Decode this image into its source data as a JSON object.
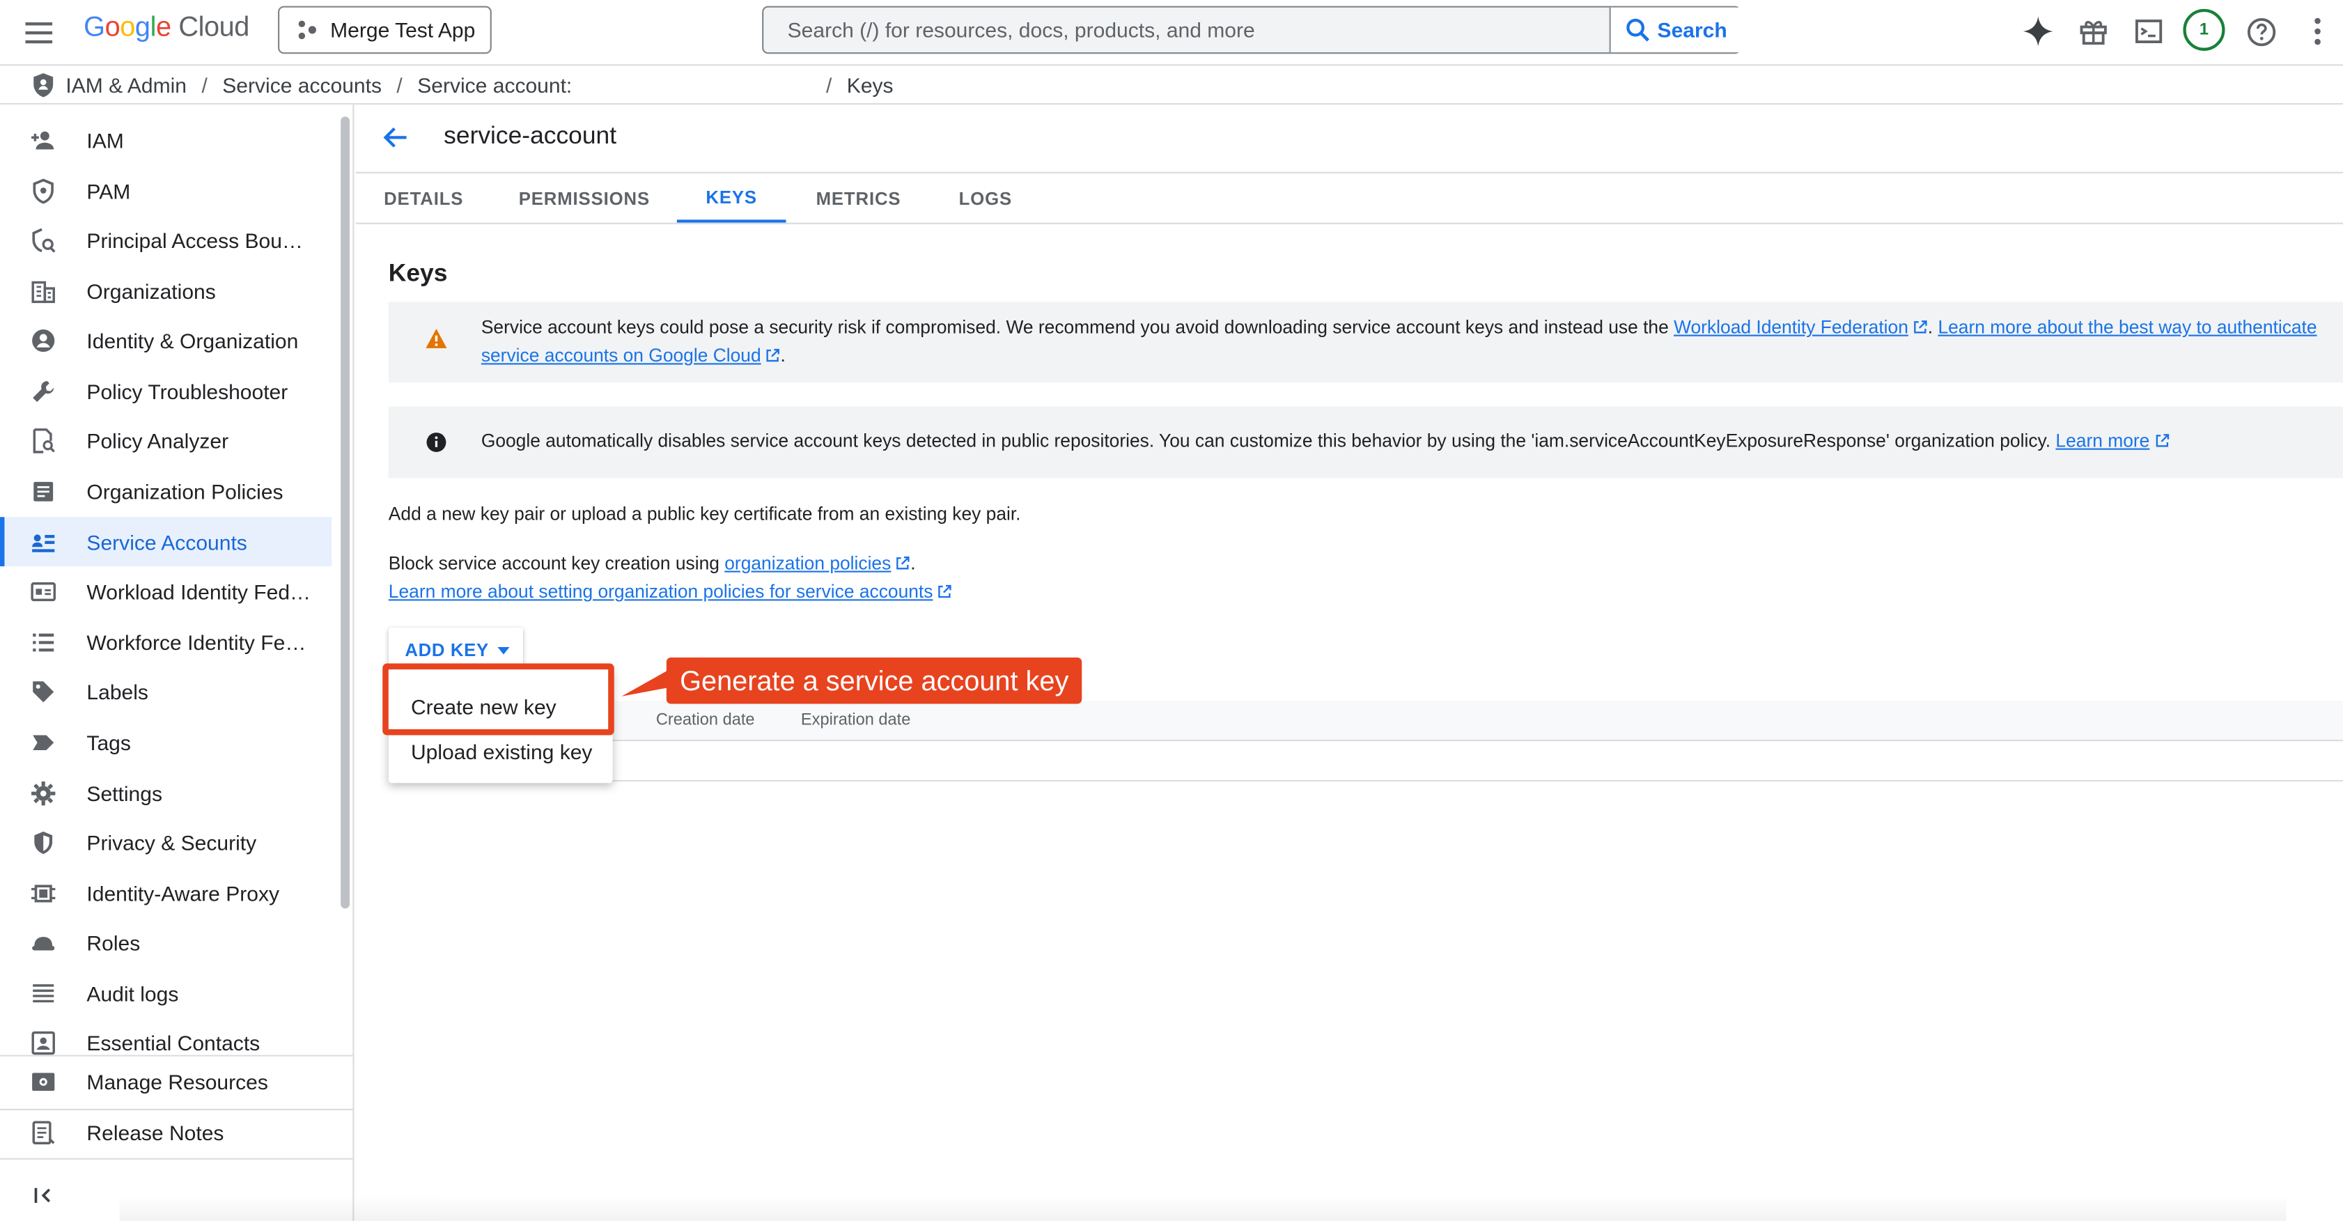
{
  "app": {
    "logo_google_letters": [
      "G",
      "o",
      "o",
      "g",
      "l",
      "e"
    ],
    "logo_cloud": "Cloud",
    "project_name": "Merge Test App",
    "search_placeholder": "Search (/) for resources, docs, products, and more",
    "search_button": "Search",
    "notification_count": "1"
  },
  "breadcrumb": {
    "items": [
      "IAM & Admin",
      "Service accounts",
      "Service account:",
      "Keys"
    ]
  },
  "sidebar": {
    "items": [
      {
        "label": "IAM",
        "icon": "person-add-icon"
      },
      {
        "label": "PAM",
        "icon": "shield-icon"
      },
      {
        "label": "Principal Access Boun...",
        "icon": "policy-shield-icon"
      },
      {
        "label": "Organizations",
        "icon": "building-icon"
      },
      {
        "label": "Identity & Organization",
        "icon": "account-circle-icon"
      },
      {
        "label": "Policy Troubleshooter",
        "icon": "wrench-icon"
      },
      {
        "label": "Policy Analyzer",
        "icon": "document-search-icon"
      },
      {
        "label": "Organization Policies",
        "icon": "list-document-icon"
      },
      {
        "label": "Service Accounts",
        "icon": "service-account-icon",
        "active": true
      },
      {
        "label": "Workload Identity Fede...",
        "icon": "id-card-icon"
      },
      {
        "label": "Workforce Identity Fed...",
        "icon": "list-icon"
      },
      {
        "label": "Labels",
        "icon": "label-icon"
      },
      {
        "label": "Tags",
        "icon": "tag-icon"
      },
      {
        "label": "Settings",
        "icon": "gear-icon"
      },
      {
        "label": "Privacy & Security",
        "icon": "security-shield-icon"
      },
      {
        "label": "Identity-Aware Proxy",
        "icon": "proxy-icon"
      },
      {
        "label": "Roles",
        "icon": "roles-icon"
      },
      {
        "label": "Audit logs",
        "icon": "lines-icon"
      },
      {
        "label": "Essential Contacts",
        "icon": "contact-icon"
      }
    ],
    "manage_resources": "Manage Resources",
    "release_notes": "Release Notes"
  },
  "page": {
    "title": "service-account",
    "tabs": [
      "DETAILS",
      "PERMISSIONS",
      "KEYS",
      "METRICS",
      "LOGS"
    ],
    "active_tab": "KEYS",
    "section_title": "Keys",
    "warning": {
      "text1": "Service account keys could pose a security risk if compromised. We recommend you avoid downloading service account keys and instead use the ",
      "link1": "Workload Identity Federation",
      "link2a": "Learn more about the best way to authenticate",
      "link2b": "service accounts on Google Cloud",
      "tail": "."
    },
    "info": {
      "text": "Google automatically disables service account keys detected in public repositories. You can customize this behavior by using the 'iam.serviceAccountKeyExposureResponse' organization policy. ",
      "link": "Learn more"
    },
    "add_key_hint": "Add a new key pair or upload a public key certificate from an existing key pair.",
    "block_text": "Block service account key creation using ",
    "block_link": "organization policies",
    "block_tail": ".",
    "learn_link": "Learn more about setting organization policies for service accounts",
    "add_key_button": "ADD KEY",
    "table_headers": [
      "Creation date",
      "Expiration date"
    ],
    "menu": [
      "Create new key",
      "Upload existing key"
    ],
    "callout": "Generate a service account key",
    "colors": {
      "accent": "#1a73e8",
      "callout": "#e8431f",
      "warning": "#e37400"
    }
  }
}
